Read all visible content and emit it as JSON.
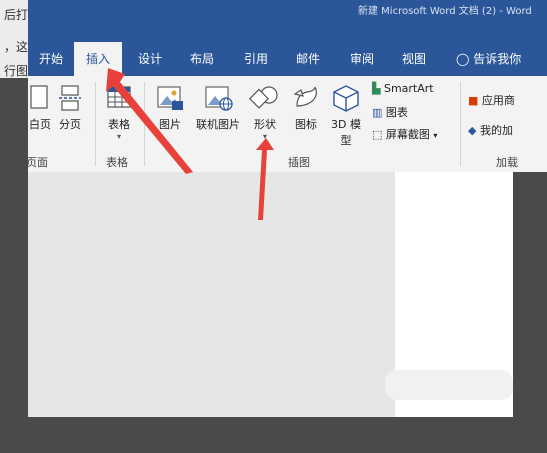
{
  "background_text": {
    "line1": "后打开，接着可以看",
    "line2": "，这",
    "line3": "行图"
  },
  "window": {
    "title": "新建 Microsoft Word 文档 (2) - Word"
  },
  "tabs": [
    {
      "label": "开始"
    },
    {
      "label": "插入"
    },
    {
      "label": "设计"
    },
    {
      "label": "布局"
    },
    {
      "label": "引用"
    },
    {
      "label": "邮件"
    },
    {
      "label": "审阅"
    },
    {
      "label": "视图"
    }
  ],
  "tell_me": "告诉我你",
  "ribbon": {
    "pages": {
      "blank_page": "白页",
      "page_break": "分页",
      "group": "页面"
    },
    "tables": {
      "table": "表格",
      "group": "表格"
    },
    "illustrations": {
      "picture": "图片",
      "online_picture": "联机图片",
      "shapes": "形状",
      "icons": "图标",
      "model3d_line1": "3D 模",
      "model3d_line2": "型",
      "smartart": "SmartArt",
      "chart": "图表",
      "screenshot": "屏幕截图",
      "group": "插图"
    },
    "addins": {
      "store": "应用商",
      "my_addins": "我的加",
      "group": "加载"
    }
  },
  "colors": {
    "accent": "#2b579a",
    "arrow": "#e8403a"
  }
}
